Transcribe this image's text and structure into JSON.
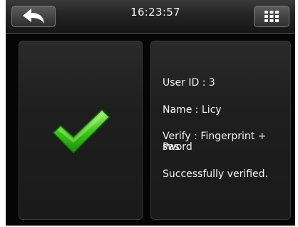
{
  "header": {
    "time": "16:23:57",
    "back_icon": "back-arrow-icon",
    "menu_icon": "grid-menu-icon"
  },
  "result": {
    "status_icon": "checkmark-icon",
    "user_id": "User ID : 3",
    "name": "Name : Licy",
    "verify_line1": "Verify : Fingerprint + Pas",
    "verify_line2": "sword",
    "message": "Successfully verified."
  },
  "colors": {
    "check_green": "#3ec91e",
    "panel_bg": "#1e1e1e",
    "text": "#f4f4f4"
  }
}
